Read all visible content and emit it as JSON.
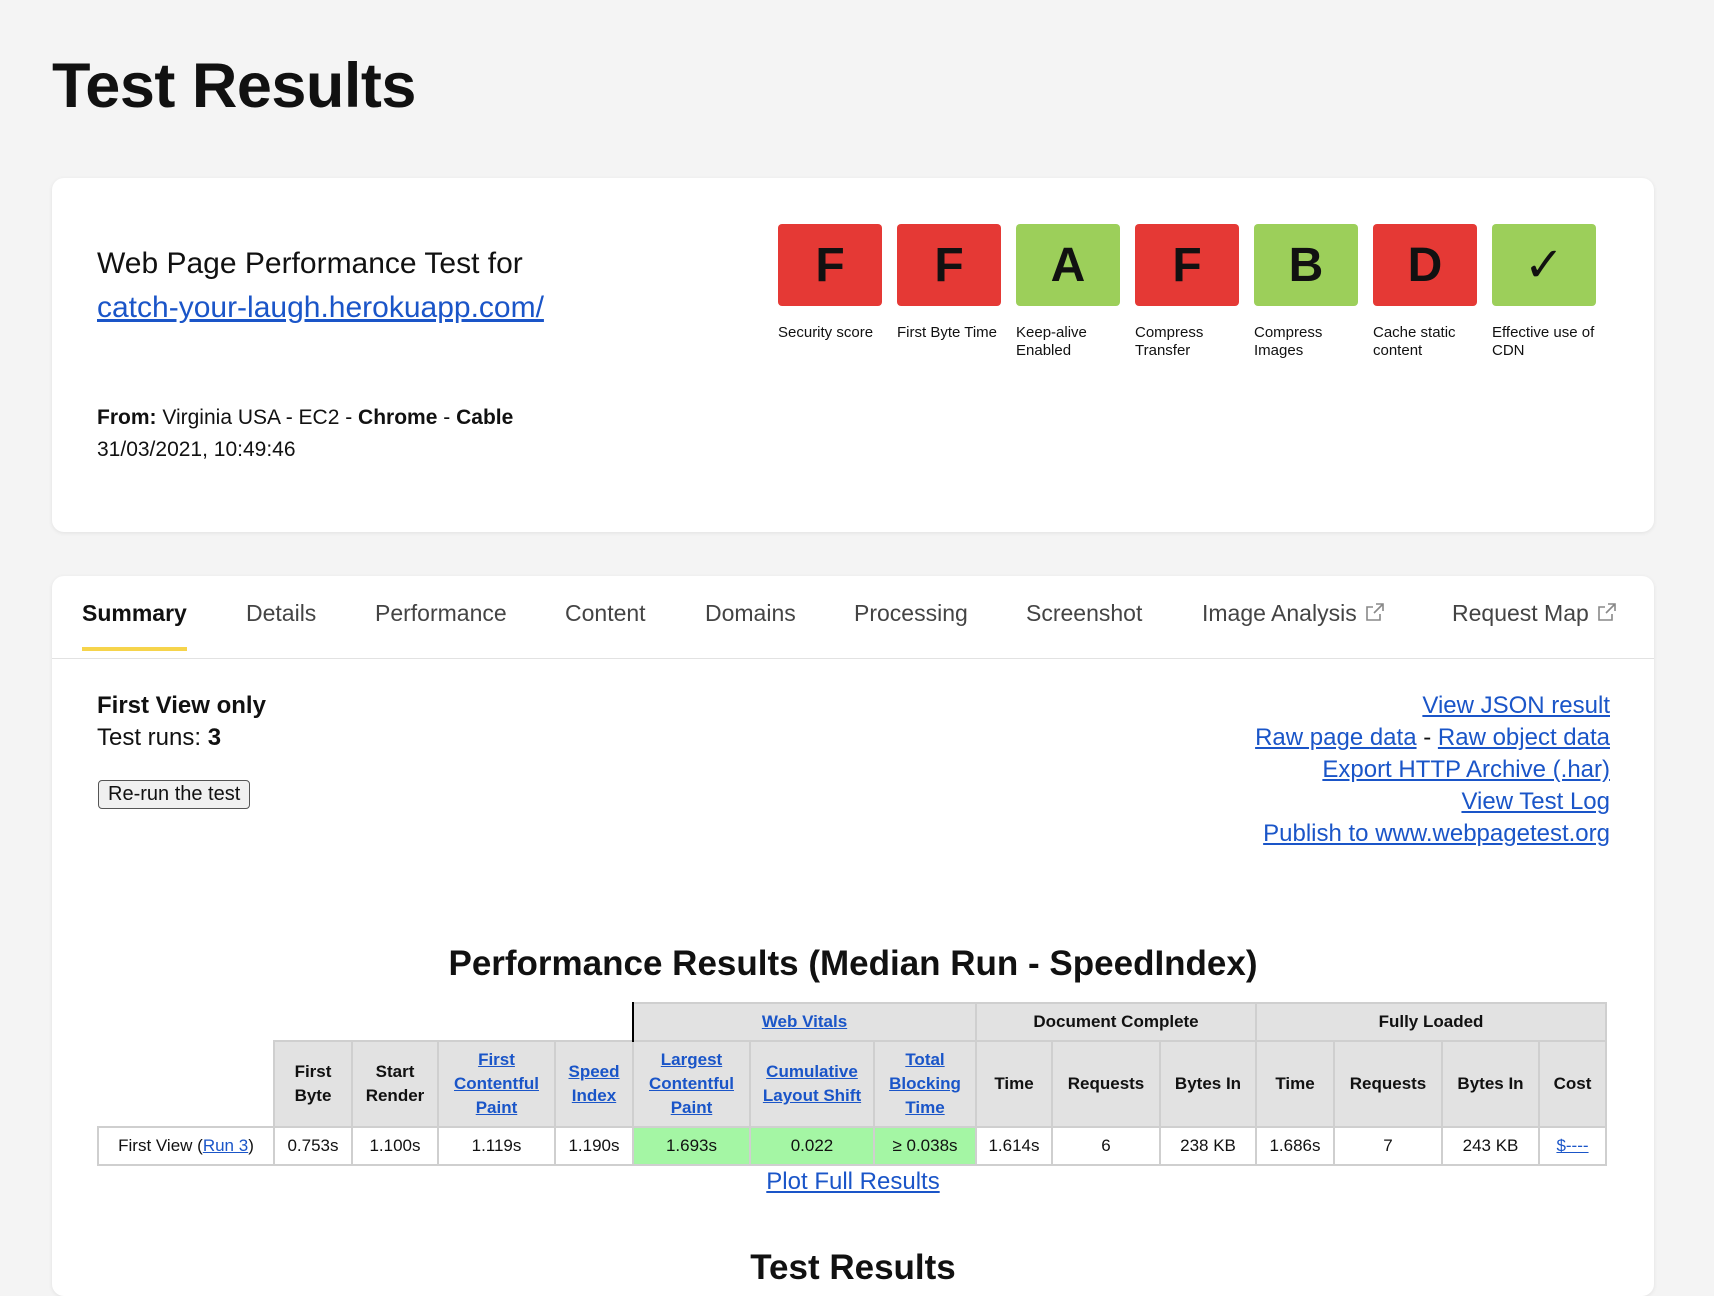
{
  "page_title": "Test Results",
  "summary": {
    "heading": "Web Page Performance Test for",
    "url": "catch-your-laugh.herokuapp.com/",
    "from_label": "From:",
    "from_location": "Virginia USA - EC2 -",
    "from_browser": "Chrome",
    "from_sep": "-",
    "from_connection": "Cable",
    "timestamp": "31/03/2021, 10:49:46"
  },
  "grades": [
    {
      "grade": "F",
      "label": "Security score",
      "color": "#e53935"
    },
    {
      "grade": "F",
      "label": "First Byte Time",
      "color": "#e53935"
    },
    {
      "grade": "A",
      "label": "Keep-alive Enabled",
      "color": "#9ccf5a"
    },
    {
      "grade": "F",
      "label": "Compress Transfer",
      "color": "#e53935"
    },
    {
      "grade": "B",
      "label": "Compress Images",
      "color": "#9ccf5a"
    },
    {
      "grade": "D",
      "label": "Cache static content",
      "color": "#e53935"
    },
    {
      "grade": "✓",
      "label": "Effective use of CDN",
      "color": "#9ccf5a"
    }
  ],
  "tabs": {
    "summary": "Summary",
    "details": "Details",
    "performance": "Performance",
    "content": "Content",
    "domains": "Domains",
    "processing": "Processing",
    "screenshot": "Screenshot",
    "image_analysis": "Image Analysis",
    "request_map": "Request Map"
  },
  "run_info": {
    "view_label": "First View only",
    "runs_label": "Test runs:",
    "runs_value": "3",
    "rerun_button": "Re-run the test"
  },
  "links": {
    "view_json": "View JSON result",
    "raw_page": "Raw page data",
    "separator": "-",
    "raw_object": "Raw object data",
    "export_har": "Export HTTP Archive (.har)",
    "test_log": "View Test Log",
    "publish": "Publish to www.webpagetest.org"
  },
  "perf": {
    "heading": "Performance Results (Median Run - SpeedIndex)",
    "groups": {
      "web_vitals": "Web Vitals",
      "document_complete": "Document Complete",
      "fully_loaded": "Fully Loaded"
    },
    "headers": {
      "first_byte": "First Byte",
      "start_render": "Start Render",
      "fcp": "First Contentful Paint",
      "speed_index": "Speed Index",
      "lcp": "Largest Contentful Paint",
      "cls": "Cumulative Layout Shift",
      "tbt": "Total Blocking Time",
      "dc_time": "Time",
      "dc_requests": "Requests",
      "dc_bytes": "Bytes In",
      "fl_time": "Time",
      "fl_requests": "Requests",
      "fl_bytes": "Bytes In",
      "cost": "Cost"
    },
    "row": {
      "label_prefix": "First View (",
      "run_link": "Run 3",
      "label_suffix": ")",
      "first_byte": "0.753s",
      "start_render": "1.100s",
      "fcp": "1.119s",
      "speed_index": "1.190s",
      "lcp": "1.693s",
      "cls": "0.022",
      "tbt": "≥ 0.038s",
      "dc_time": "1.614s",
      "dc_requests": "6",
      "dc_bytes": "238 KB",
      "fl_time": "1.686s",
      "fl_requests": "7",
      "fl_bytes": "243 KB",
      "cost": "$----"
    },
    "plot_link": "Plot Full Results"
  },
  "second_heading": "Test Results"
}
